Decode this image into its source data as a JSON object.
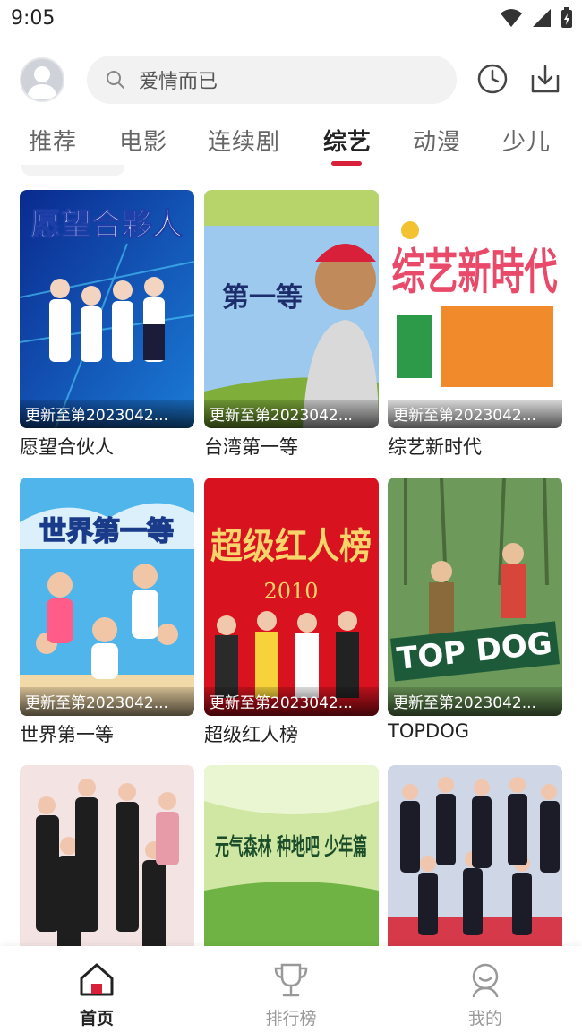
{
  "status_bar": {
    "time": "9:05"
  },
  "search": {
    "placeholder": "爱情而已"
  },
  "tabs": [
    {
      "label": "推荐"
    },
    {
      "label": "电影"
    },
    {
      "label": "连续剧"
    },
    {
      "label": "综艺",
      "active": true
    },
    {
      "label": "动漫"
    },
    {
      "label": "少儿"
    }
  ],
  "cards": [
    {
      "title": "愿望合伙人",
      "update": "更新至第2023042...",
      "poster_text": "愿望合夥人"
    },
    {
      "title": "台湾第一等",
      "update": "更新至第2023042...",
      "poster_text": "第一等"
    },
    {
      "title": "综艺新时代",
      "update": "更新至第2023042...",
      "poster_text": "综艺新時代"
    },
    {
      "title": "世界第一等",
      "update": "更新至第2023042...",
      "poster_text": "世界第一等"
    },
    {
      "title": "超级红人榜",
      "update": "更新至第2023042...",
      "poster_text": "超级红人榜",
      "poster_year": "2010"
    },
    {
      "title": "TOPDOG",
      "update": "更新至第2023042...",
      "poster_text": "TOP DOG"
    },
    {
      "title": "",
      "update": ""
    },
    {
      "title": "",
      "update": "",
      "poster_text": "元气森林 种地吧 少年篇"
    },
    {
      "title": "",
      "update": ""
    }
  ],
  "bottom_nav": [
    {
      "label": "首页",
      "icon": "home-icon",
      "active": true
    },
    {
      "label": "排行榜",
      "icon": "trophy-icon"
    },
    {
      "label": "我的",
      "icon": "profile-icon"
    }
  ],
  "colors": {
    "accent": "#d8203a",
    "active_text": "#222222",
    "inactive_text": "#999999"
  }
}
